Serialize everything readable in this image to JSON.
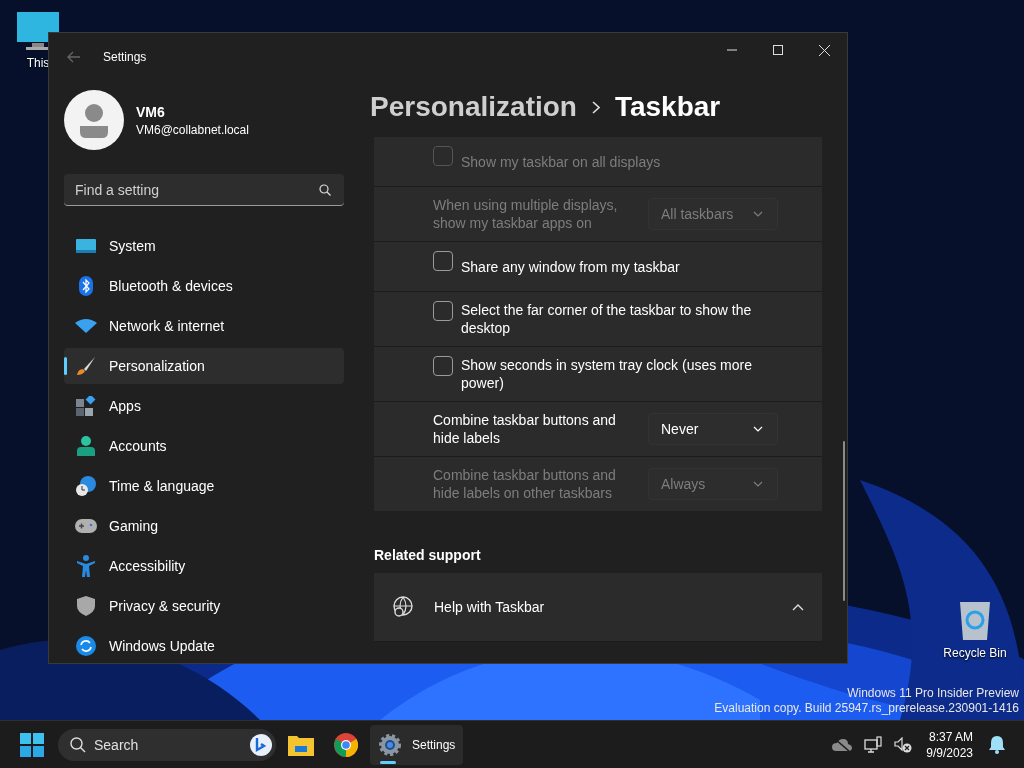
{
  "desktop": {
    "icons": [
      {
        "kind": "computer",
        "label": "This"
      },
      {
        "kind": "recycle",
        "label": "Recycle Bin"
      }
    ],
    "watermark": [
      "Windows 11 Pro Insider Preview",
      "Evaluation copy. Build 25947.rs_prerelease.230901-1416"
    ]
  },
  "window": {
    "title": "Settings",
    "user": {
      "name": "VM6",
      "email": "VM6@collabnet.local"
    },
    "search": {
      "placeholder": "Find a setting"
    },
    "sidebar": {
      "items": [
        {
          "label": "System",
          "selected": false
        },
        {
          "label": "Bluetooth & devices",
          "selected": false
        },
        {
          "label": "Network & internet",
          "selected": false
        },
        {
          "label": "Personalization",
          "selected": true
        },
        {
          "label": "Apps",
          "selected": false
        },
        {
          "label": "Accounts",
          "selected": false
        },
        {
          "label": "Time & language",
          "selected": false
        },
        {
          "label": "Gaming",
          "selected": false
        },
        {
          "label": "Accessibility",
          "selected": false
        },
        {
          "label": "Privacy & security",
          "selected": false
        },
        {
          "label": "Windows Update",
          "selected": false
        }
      ]
    },
    "breadcrumb": [
      "Personalization",
      "Taskbar"
    ],
    "settings": [
      {
        "kind": "checkbox",
        "label": "Show my taskbar on all displays",
        "checked": false,
        "disabled": true
      },
      {
        "kind": "dropdown",
        "label": "When using multiple displays, show my taskbar apps on",
        "value": "All taskbars",
        "disabled": true
      },
      {
        "kind": "checkbox",
        "label": "Share any window from my taskbar",
        "checked": false,
        "disabled": false
      },
      {
        "kind": "checkbox",
        "label": "Select the far corner of the taskbar to show the desktop",
        "checked": false,
        "disabled": false
      },
      {
        "kind": "checkbox",
        "label": "Show seconds in system tray clock (uses more power)",
        "checked": false,
        "disabled": false
      },
      {
        "kind": "dropdown",
        "label": "Combine taskbar buttons and hide labels",
        "value": "Never",
        "disabled": false
      },
      {
        "kind": "dropdown",
        "label": "Combine taskbar buttons and hide labels on other taskbars",
        "value": "Always",
        "disabled": true
      }
    ],
    "related": {
      "heading": "Related support",
      "items": [
        {
          "label": "Help with Taskbar",
          "expanded": true
        }
      ]
    }
  },
  "taskbar": {
    "search": {
      "placeholder": "Search"
    },
    "apps": [
      {
        "kind": "folder",
        "selected": false
      },
      {
        "kind": "browser",
        "selected": false
      },
      {
        "kind": "gear",
        "label": "Settings",
        "selected": true
      }
    ],
    "clock": {
      "time": "8:37 AM",
      "date": "9/9/2023"
    }
  }
}
